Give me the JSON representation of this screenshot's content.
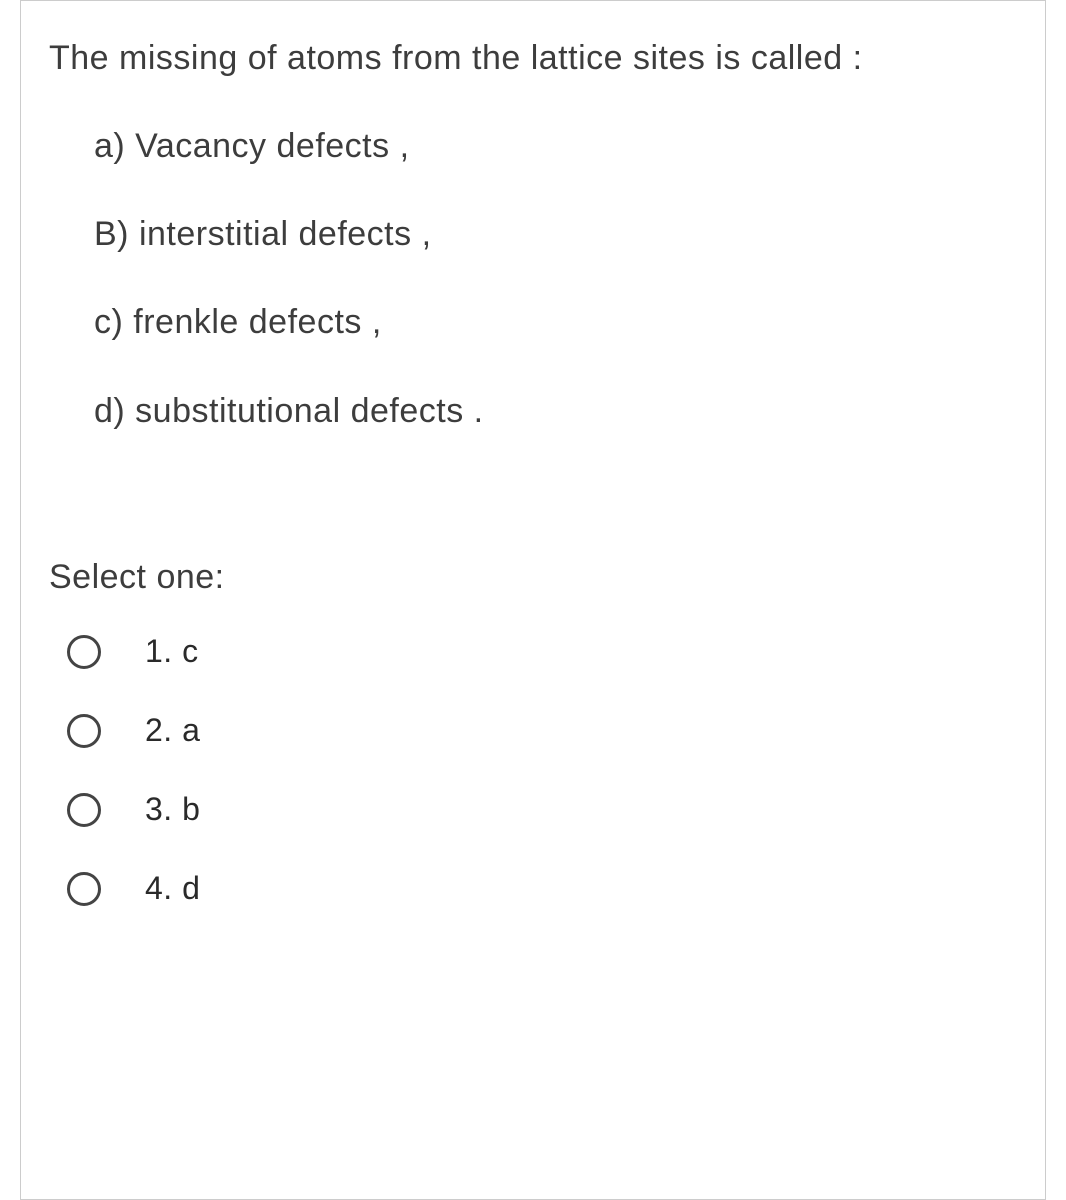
{
  "question": {
    "prompt": "The missing of atoms  from the lattice sites  is called :",
    "options": [
      "a) Vacancy defects ,",
      "B) interstitial defects ,",
      "c) frenkle defects ,",
      "d) substitutional  defects ."
    ]
  },
  "select_label": "Select one:",
  "answers": [
    {
      "label": "1. c"
    },
    {
      "label": "2. a"
    },
    {
      "label": "3. b"
    },
    {
      "label": "4. d"
    }
  ]
}
